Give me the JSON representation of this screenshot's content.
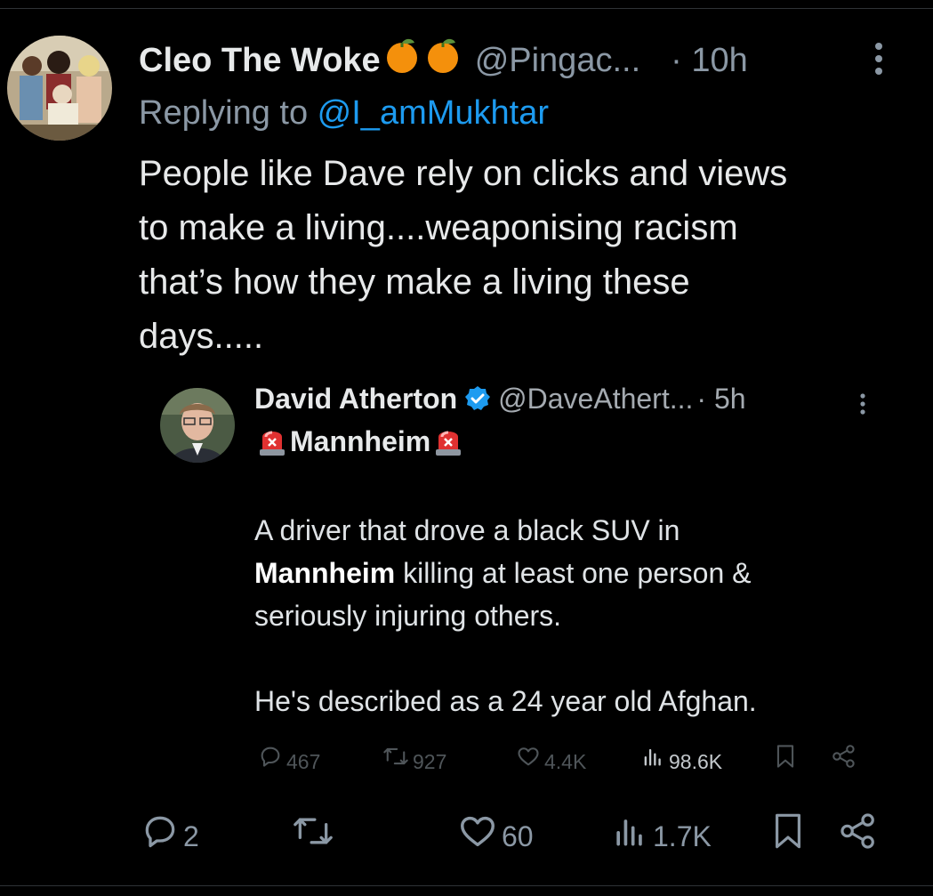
{
  "tweet": {
    "display_name": "Cleo The Woke",
    "name_emoji": "orange-emoji",
    "handle": "@Pingac...",
    "time": "· 10h",
    "reply_prefix": "Replying to ",
    "reply_mention": "@I_amMukhtar",
    "text": "People like Dave rely on clicks and views\nto make a living....weaponising racism\nthat’s how they make a living these\ndays.....",
    "actions": {
      "replies": "2",
      "retweets": "",
      "likes": "60",
      "views": "1.7K"
    }
  },
  "quoted": {
    "display_name": "David Atherton",
    "handle": "@DaveAthert...",
    "time": "· 5h",
    "title": "Mannheim",
    "title_icon": "siren-icon",
    "body_line1": "A driver that drove a black SUV in",
    "body_line2_bold": "Mannheim",
    "body_line2_rest": " killing at least one person &",
    "body_line3": "seriously injuring others.",
    "body_line4": "He's described as a 24 year old Afghan.",
    "actions": {
      "replies": "467",
      "retweets": "927",
      "likes": "4.4K",
      "views": "98.6K"
    }
  },
  "colors": {
    "background": "#000000",
    "text": "#e7e9ea",
    "muted": "#8b98a5",
    "link": "#1d9bf0",
    "verified": "#1d9bf0"
  }
}
